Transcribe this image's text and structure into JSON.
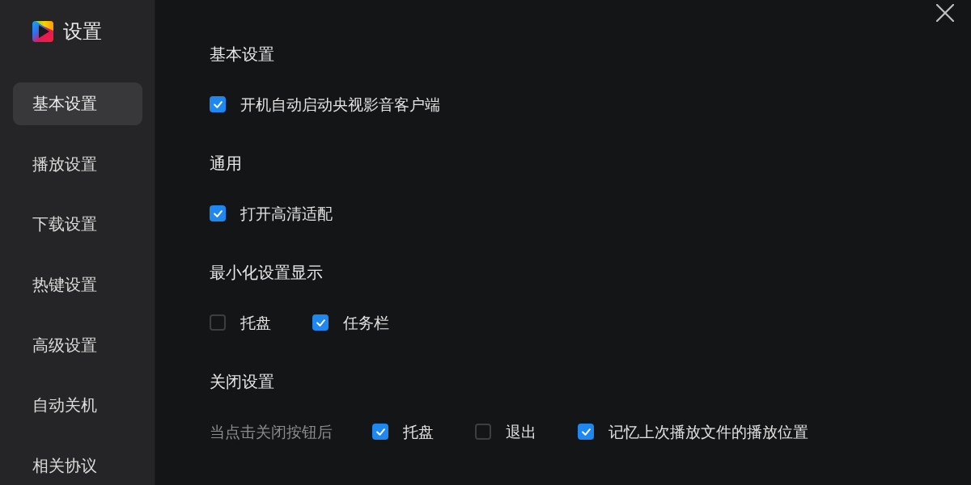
{
  "window": {
    "title": "设置"
  },
  "sidebar": {
    "items": [
      {
        "label": "基本设置",
        "selected": true
      },
      {
        "label": "播放设置",
        "selected": false
      },
      {
        "label": "下载设置",
        "selected": false
      },
      {
        "label": "热键设置",
        "selected": false
      },
      {
        "label": "高级设置",
        "selected": false
      },
      {
        "label": "自动关机",
        "selected": false
      },
      {
        "label": "相关协议",
        "selected": false
      }
    ]
  },
  "sections": [
    {
      "title": "基本设置",
      "options": [
        {
          "label": "开机自动启动央视影音客户端",
          "checked": true
        }
      ]
    },
    {
      "title": "通用",
      "options": [
        {
          "label": "打开高清适配",
          "checked": true
        }
      ]
    },
    {
      "title": "最小化设置显示",
      "options": [
        {
          "label": "托盘",
          "checked": false
        },
        {
          "label": "任务栏",
          "checked": true
        }
      ]
    },
    {
      "title": "关闭设置",
      "prompt": "当点击关闭按钮后",
      "options": [
        {
          "label": "托盘",
          "checked": true
        },
        {
          "label": "退出",
          "checked": false
        },
        {
          "label": "记忆上次播放文件的播放位置",
          "checked": true
        }
      ]
    }
  ]
}
